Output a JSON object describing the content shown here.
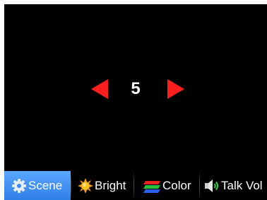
{
  "screen": {
    "value": "5",
    "colors": {
      "background": "#000000",
      "arrow": "#ff1e1e",
      "active_tab": "#3b8cf0",
      "text": "#ffffff"
    }
  },
  "controls": {
    "decrease_icon": "triangle-left-icon",
    "increase_icon": "triangle-right-icon"
  },
  "tabs": [
    {
      "label": "Scene",
      "icon": "gear-icon",
      "active": true
    },
    {
      "label": "Bright",
      "icon": "sun-icon",
      "active": false
    },
    {
      "label": "Color",
      "icon": "rgb-bars-icon",
      "active": false
    },
    {
      "label": "Talk Vol",
      "icon": "speaker-icon",
      "active": false
    }
  ]
}
